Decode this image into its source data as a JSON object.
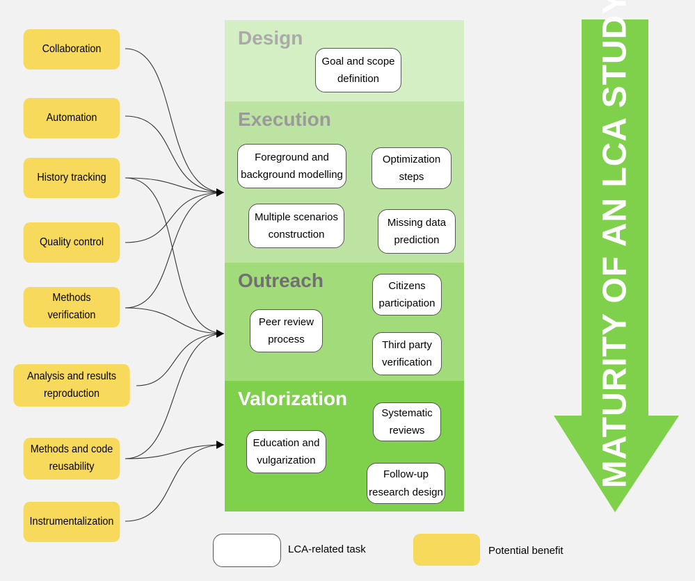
{
  "benefits": [
    {
      "label": "Collaboration"
    },
    {
      "label": "Automation"
    },
    {
      "label": "History tracking"
    },
    {
      "label": "Quality control"
    },
    {
      "label": "Methods\nverification"
    },
    {
      "label": "Analysis and results\nreproduction"
    },
    {
      "label": "Methods and code\nreusability"
    },
    {
      "label": "Instrumentalization"
    }
  ],
  "stages": {
    "design": {
      "title": "Design",
      "color": "#d5efc4",
      "title_color": "#aaaaaa",
      "tasks": [
        "Goal and scope\ndefinition"
      ]
    },
    "execution": {
      "title": "Execution",
      "color": "#bde3a3",
      "title_color": "#9a9a9a",
      "tasks": [
        "Foreground and\nbackground modelling",
        "Optimization\nsteps",
        "Multiple scenarios\nconstruction",
        "Missing data\nprediction"
      ]
    },
    "outreach": {
      "title": "Outreach",
      "color": "#a2db79",
      "title_color": "#707070",
      "tasks": [
        "Citizens\nparticipation",
        "Peer review\nprocess",
        "Third party\nverification"
      ]
    },
    "valorization": {
      "title": "Valorization",
      "color": "#7fd04a",
      "title_color": "#ffffff",
      "tasks": [
        "Systematic\nreviews",
        "Education and\nvulgarization",
        "Follow-up\nresearch design"
      ]
    }
  },
  "big_arrow": {
    "label": "MATURITY OF AN LCA STUDY",
    "color": "#7fd04a"
  },
  "legend": {
    "task_label": "LCA-related task",
    "benefit_label": "Potential benefit",
    "benefit_color": "#f7d95c"
  }
}
